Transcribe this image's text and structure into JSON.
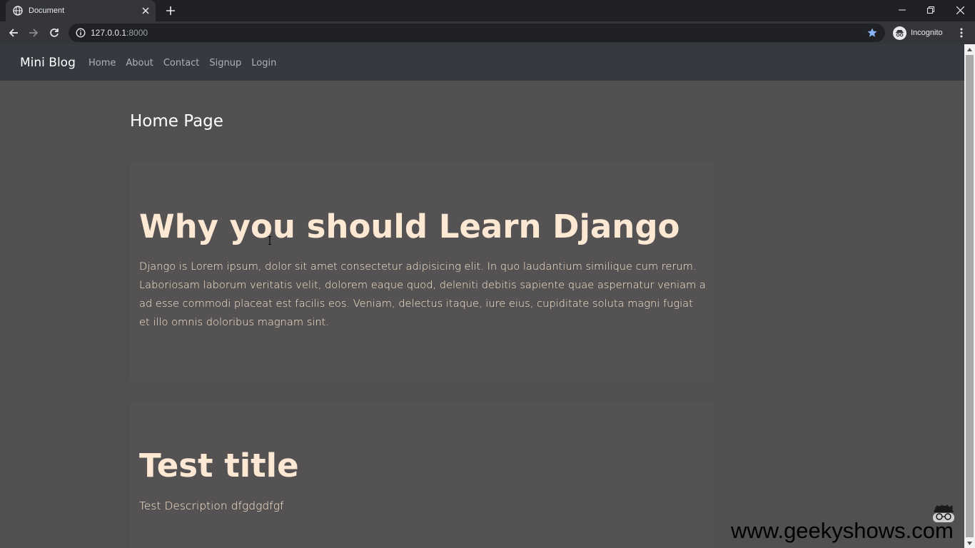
{
  "browser": {
    "tab_title": "Document",
    "url_host": "127.0.0.1",
    "url_port": ":8000",
    "profile_label": "Incognito",
    "icons": [
      "globe-icon",
      "close-icon",
      "plus-icon",
      "minimize-icon",
      "restore-icon",
      "back-icon",
      "forward-icon",
      "reload-icon",
      "info-icon",
      "star-icon",
      "incognito-icon",
      "menu-icon"
    ],
    "accent_color": "#8ab4f8"
  },
  "navbar": {
    "brand": "Mini Blog",
    "links": [
      "Home",
      "About",
      "Contact",
      "Signup",
      "Login"
    ],
    "background": "#343a40"
  },
  "page": {
    "title": "Home Page"
  },
  "posts": [
    {
      "title": "Why you should Learn Django",
      "body": "Django is Lorem ipsum, dolor sit amet consectetur adipisicing elit. In quo laudantium similique cum rerum. Laboriosam laborum veritatis velit, dolorem eaque quod, deleniti debitis sapiente quae aspernatur veniam a ad esse commodi placeat est facilis eos. Veniam, delectus itaque, iure eius, cupiditate soluta magni fugiat et illo omnis doloribus magnam sint."
    },
    {
      "title": "Test title",
      "body": "Test Description dfgdgdfgf"
    }
  ],
  "watermark": {
    "text": "www.geekyshows.com"
  }
}
